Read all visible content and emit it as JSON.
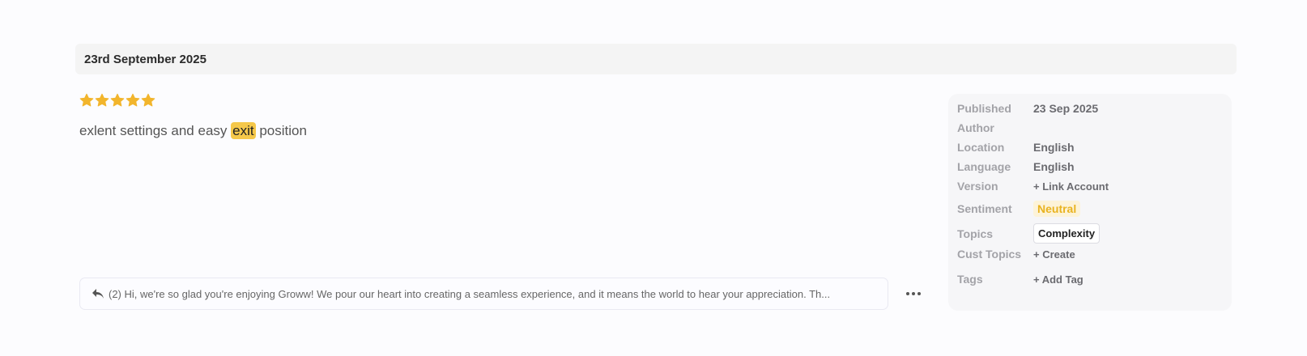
{
  "date_header": "23rd September 2025",
  "review": {
    "rating": 5,
    "text_before": "exlent settings and easy ",
    "highlight": "exit",
    "text_after": " position",
    "star_color": "#f2b52c"
  },
  "reply": {
    "icon": "reply-icon",
    "text": "(2) Hi, we're so glad you're enjoying Groww! We pour our heart into creating a seamless experience, and it means the world to hear your appreciation. Th..."
  },
  "more_icon": "more-dots-icon",
  "meta": {
    "published": {
      "label": "Published",
      "value": "23 Sep 2025"
    },
    "author": {
      "label": "Author",
      "value": ""
    },
    "location": {
      "label": "Location",
      "value": "English"
    },
    "language": {
      "label": "Language",
      "value": "English"
    },
    "version": {
      "label": "Version",
      "action": "+ Link Account"
    },
    "sentiment": {
      "label": "Sentiment",
      "value": "Neutral",
      "color": "#e9b320"
    },
    "topics": {
      "label": "Topics",
      "chips": [
        "Complexity"
      ]
    },
    "cust_topics": {
      "label": "Cust Topics",
      "action": "+ Create"
    },
    "tags": {
      "label": "Tags",
      "action": "+ Add Tag"
    }
  }
}
